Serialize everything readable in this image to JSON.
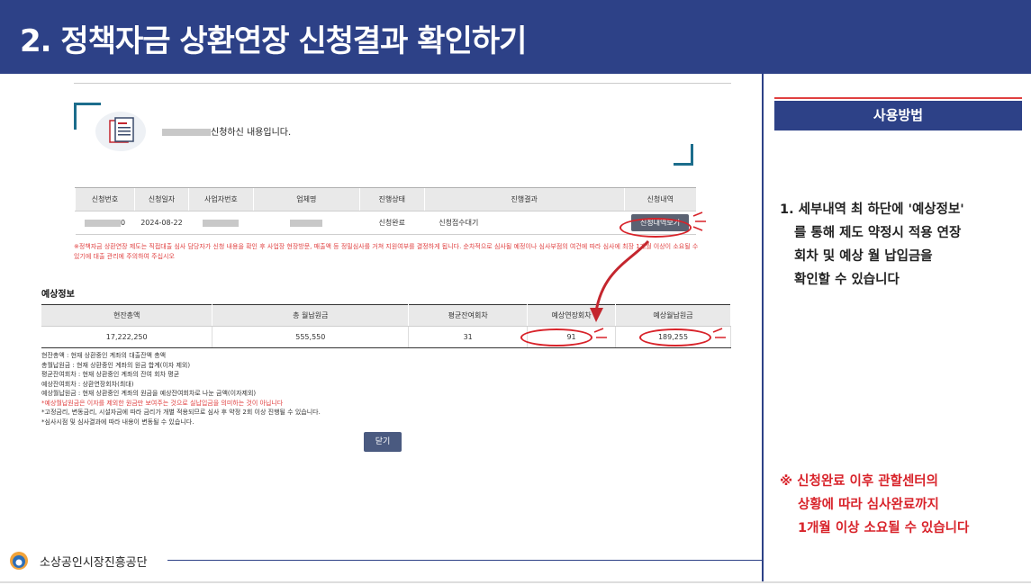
{
  "slide": {
    "title": "2. 정책자금 상환연장 신청결과 확인하기"
  },
  "app": {
    "applied_text": "신청하신 내용입니다.",
    "table1": {
      "headers": [
        "신청번호",
        "신청일자",
        "사업자번호",
        "업체명",
        "진행상태",
        "진행결과",
        "신청내역"
      ],
      "row": {
        "no_suffix": "0",
        "date": "2024-08-22",
        "status": "신청완료",
        "result": "신청접수대기",
        "button": "신청내역보기"
      }
    },
    "warning": "※정책자금 상환연장 제도는 직접대출 심사 담당자가 신청 내용을 확인 후 사업장 현장방문, 매출액 등 정밀심사를 거쳐 지원여부를 결정하게 됩니다. 순차적으로 심사될 예정이나 심사부점의 여건에 따라 심사에 최장 1개월 이상이 소요될 수 있기에 대출 관리에 주의하여 주십시오",
    "estimate": {
      "title": "예상정보",
      "headers": [
        "현잔총액",
        "총 월납원금",
        "평균잔여회차",
        "예상연장회차",
        "예상월납원금"
      ],
      "values": [
        "17,222,250",
        "555,550",
        "31",
        "91",
        "189,255"
      ]
    },
    "notes": [
      "현잔총액 : 현재 상환중인 계좌의 대출잔액 총액",
      "총월납원금 : 현재 상환중인 계좌의 원금 합계(이자 제외)",
      "평균잔여회차 : 현재 상환중인 계좌의 잔여 회차 평균",
      "예상잔여회차 : 상환연장회차(최대)",
      "예상월납원금 : 현재 상환중인 계좌의 원금을 예상잔여회차로 나눈 금액(이자제외)",
      "*예상월납원금은 이자를 제외한 원금만 보여주는 것으로 실납입금을 의미하는 것이 아닙니다",
      "*고정금리, 변동금리, 시설자금에 따라 금리가 개별 적용되므로 심사 후 약정 2회 이상 진행될 수 있습니다.",
      "*심사시점 및 심사결과에 따라 내용이 변동될 수 있습니다."
    ],
    "close_button": "닫기"
  },
  "panel": {
    "heading": "사용방법",
    "step_lines": [
      "1. 세부내역 최 하단에 '예상정보'",
      "를 통해 제도 약정시 적용 연장",
      "회차 및 예상 월 납입금을",
      "확인할 수 있습니다"
    ],
    "note_lines": [
      "※ 신청완료 이후 관할센터의",
      "상황에 따라 심사완료까지",
      "1개월 이상 소요될 수 있습니다"
    ]
  },
  "footer": {
    "org": "소상공인시장진흥공단"
  },
  "colors": {
    "navy": "#2d4187",
    "red": "#d8232a",
    "teal": "#1c6d8c"
  }
}
